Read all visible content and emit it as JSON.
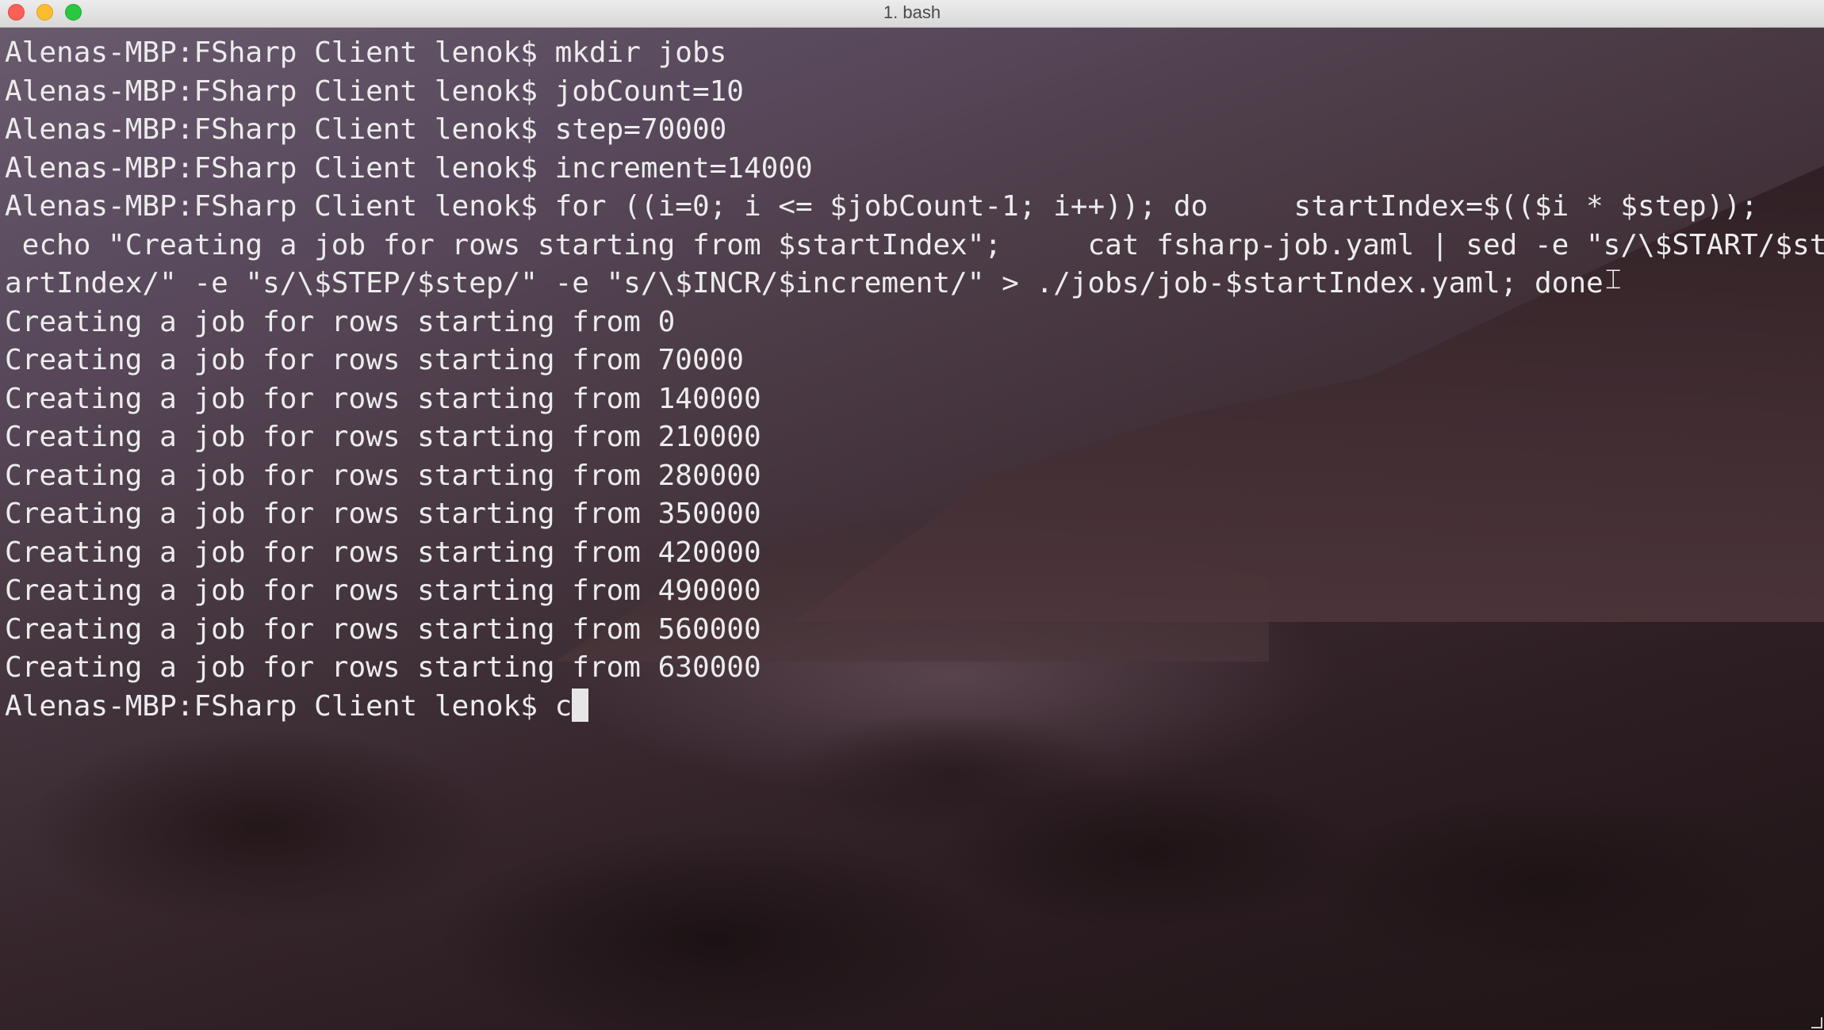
{
  "window": {
    "title": "1. bash",
    "colors": {
      "close": "#fc5f57",
      "minimize": "#fdbc2e",
      "maximize": "#29c840",
      "text": "#ececec"
    }
  },
  "terminal": {
    "lines": [
      "Alenas-MBP:FSharp Client lenok$ mkdir jobs",
      "Alenas-MBP:FSharp Client lenok$ jobCount=10",
      "Alenas-MBP:FSharp Client lenok$ step=70000",
      "Alenas-MBP:FSharp Client lenok$ increment=14000",
      "Alenas-MBP:FSharp Client lenok$ for ((i=0; i <= $jobCount-1; i++)); do     startIndex=$(($i * $step));",
      " echo \"Creating a job for rows starting from $startIndex\";     cat fsharp-job.yaml | sed -e \"s/\\$START/$st",
      "artIndex/\" -e \"s/\\$STEP/$step/\" -e \"s/\\$INCR/$increment/\" > ./jobs/job-$startIndex.yaml; done",
      "Creating a job for rows starting from 0",
      "Creating a job for rows starting from 70000",
      "Creating a job for rows starting from 140000",
      "Creating a job for rows starting from 210000",
      "Creating a job for rows starting from 280000",
      "Creating a job for rows starting from 350000",
      "Creating a job for rows starting from 420000",
      "Creating a job for rows starting from 490000",
      "Creating a job for rows starting from 560000",
      "Creating a job for rows starting from 630000"
    ],
    "prompt_line": "Alenas-MBP:FSharp Client lenok$ c",
    "cursor_icon": "text-ibeam-cursor"
  }
}
